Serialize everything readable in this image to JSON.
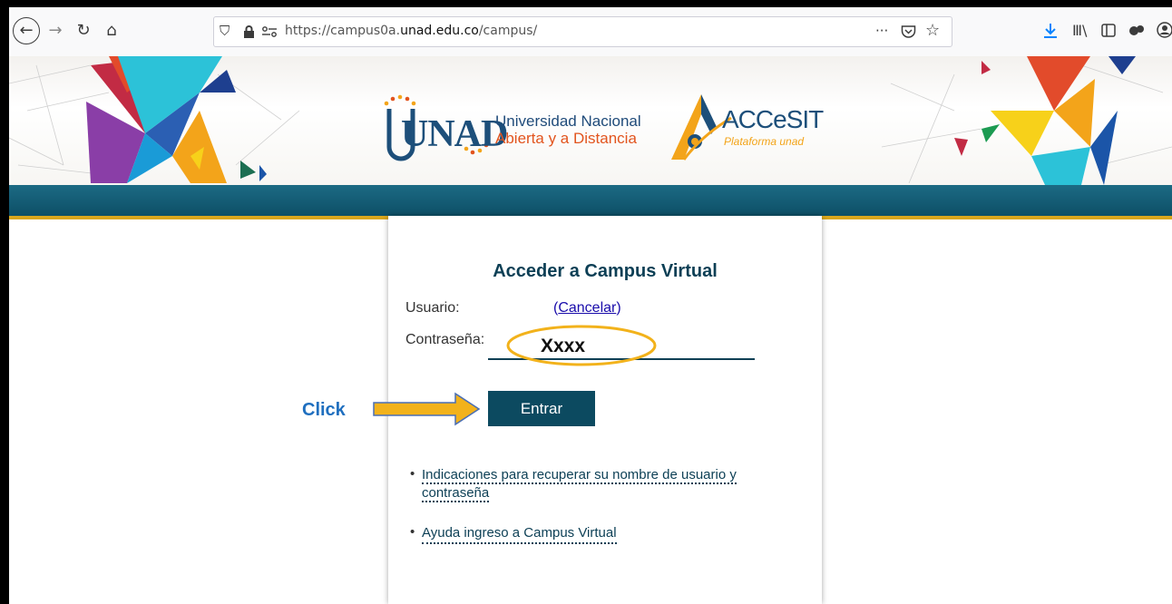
{
  "browser": {
    "url_prefix": "https://campus0a.",
    "url_domain": "unad.edu.co",
    "url_path": "/campus/",
    "icons": [
      "back-icon",
      "forward-icon",
      "reload-icon",
      "home-icon",
      "shield-icon",
      "lock-icon",
      "site-permissions-icon",
      "page-actions-icon",
      "pocket-icon",
      "bookmark-star-icon",
      "download-icon",
      "library-icon",
      "sidebar-icon",
      "extension-icon",
      "account-icon"
    ],
    "page_actions": "···"
  },
  "banner": {
    "unad_logo": "UNAD",
    "university_line1": "Universidad Nacional",
    "university_line2": "Abierta y a Distancia",
    "accesit_logo": "ACCeSIT",
    "accesit_sub": "Plataforma unad"
  },
  "login": {
    "title": "Acceder a Campus Virtual",
    "user_label": "Usuario:",
    "cancel_label": "Cancelar",
    "password_label": "Contraseña:",
    "password_value": "Xxxx",
    "submit_label": "Entrar",
    "help_links": [
      {
        "line1": "Indicaciones para recuperar su nombre de usuario y",
        "line2": "contraseña"
      },
      {
        "line1": "Ayuda ingreso a Campus Virtual",
        "line2": ""
      }
    ]
  },
  "annotation": {
    "click_label": "Click",
    "highlight_color": "#f2b21b",
    "arrow_color": "#f2b21b"
  },
  "colors": {
    "accent_teal": "#0c4a60",
    "banner_bar": "#1c6a84",
    "gold": "#d9a61d"
  }
}
